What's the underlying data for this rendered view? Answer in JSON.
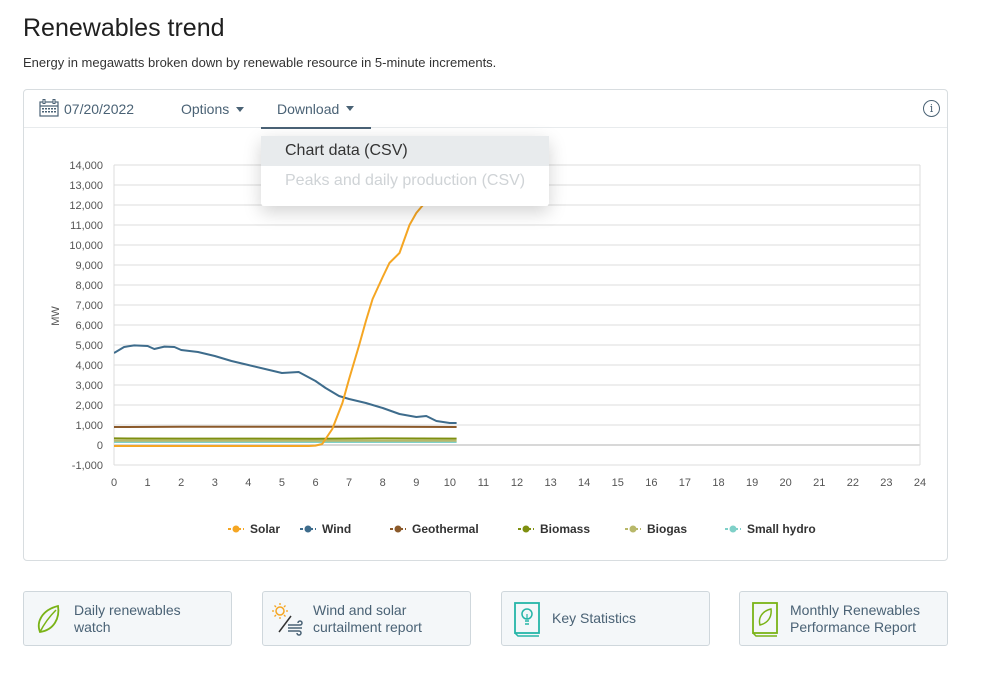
{
  "page": {
    "title": "Renewables trend",
    "subtitle": "Energy in megawatts broken down by renewable resource in 5-minute increments."
  },
  "toolbar": {
    "date": "07/20/2022",
    "options_label": "Options",
    "download_label": "Download",
    "info_icon": "info-icon",
    "calendar_icon": "calendar-icon"
  },
  "download_menu": {
    "items": [
      {
        "label": "Chart data (CSV)",
        "state": "hover"
      },
      {
        "label": "Peaks and daily production (CSV)",
        "state": "disabled"
      }
    ]
  },
  "cards": [
    {
      "label_line1": "Daily renewables",
      "label_line2": "watch",
      "icon": "leaf-icon"
    },
    {
      "label_line1": "Wind and solar",
      "label_line2": "curtailment report",
      "icon": "sun-wind-icon"
    },
    {
      "label_line1": "Key Statistics",
      "label_line2": "",
      "icon": "lightbulb-book-icon"
    },
    {
      "label_line1": "Monthly Renewables",
      "label_line2": "Performance Report",
      "icon": "leaf-book-icon"
    }
  ],
  "chart_data": {
    "type": "line",
    "title": "",
    "xlabel": "",
    "ylabel": "MW",
    "xlim": [
      0,
      24
    ],
    "ylim": [
      -1000,
      14000
    ],
    "x_ticks": [
      "0",
      "1",
      "2",
      "3",
      "4",
      "5",
      "6",
      "7",
      "8",
      "9",
      "10",
      "11",
      "12",
      "13",
      "14",
      "15",
      "16",
      "17",
      "18",
      "19",
      "20",
      "21",
      "22",
      "23",
      "24"
    ],
    "y_ticks": [
      "-1,000",
      "0",
      "1,000",
      "2,000",
      "3,000",
      "4,000",
      "5,000",
      "6,000",
      "7,000",
      "8,000",
      "9,000",
      "10,000",
      "11,000",
      "12,000",
      "13,000",
      "14,000"
    ],
    "y_tick_values": [
      -1000,
      0,
      1000,
      2000,
      3000,
      4000,
      5000,
      6000,
      7000,
      8000,
      9000,
      10000,
      11000,
      12000,
      13000,
      14000
    ],
    "grid": true,
    "legend_position": "bottom",
    "series": [
      {
        "name": "Solar",
        "color": "#f5a623",
        "x": [
          0,
          1,
          2,
          3,
          4,
          5,
          5.8,
          6.0,
          6.2,
          6.5,
          6.8,
          7.0,
          7.3,
          7.5,
          7.7,
          8.0,
          8.2,
          8.5,
          8.8,
          9.0,
          9.2
        ],
        "values": [
          -50,
          -50,
          -50,
          -50,
          -50,
          -50,
          -50,
          -30,
          50,
          800,
          2100,
          3300,
          5000,
          6200,
          7300,
          8400,
          9100,
          9600,
          11000,
          11600,
          12000
        ]
      },
      {
        "name": "Wind",
        "color": "#3e6c8c",
        "x": [
          0,
          0.3,
          0.6,
          1.0,
          1.2,
          1.5,
          1.8,
          2.0,
          2.5,
          3.0,
          3.5,
          4.0,
          4.5,
          5.0,
          5.5,
          6.0,
          6.3,
          6.7,
          7.0,
          7.5,
          8.0,
          8.5,
          9.0,
          9.3,
          9.6,
          10.0,
          10.2
        ],
        "values": [
          4600,
          4900,
          4980,
          4950,
          4800,
          4920,
          4900,
          4750,
          4650,
          4450,
          4200,
          4000,
          3800,
          3600,
          3650,
          3200,
          2850,
          2450,
          2300,
          2100,
          1850,
          1550,
          1400,
          1450,
          1200,
          1100,
          1100
        ]
      },
      {
        "name": "Geothermal",
        "color": "#8b5a2b",
        "x": [
          0,
          2,
          4,
          6,
          8,
          10.2
        ],
        "values": [
          900,
          910,
          910,
          910,
          910,
          900
        ]
      },
      {
        "name": "Biomass",
        "color": "#7e8f10",
        "x": [
          0,
          2,
          4,
          6,
          8,
          10.2
        ],
        "values": [
          330,
          320,
          320,
          310,
          330,
          320
        ]
      },
      {
        "name": "Biogas",
        "color": "#b8b86a",
        "x": [
          0,
          2,
          4,
          6,
          8,
          10.2
        ],
        "values": [
          210,
          210,
          210,
          210,
          215,
          210
        ]
      },
      {
        "name": "Small hydro",
        "color": "#7fd0c8",
        "x": [
          0,
          2,
          4,
          6,
          8,
          10.2
        ],
        "values": [
          150,
          150,
          150,
          150,
          150,
          150
        ]
      }
    ]
  }
}
